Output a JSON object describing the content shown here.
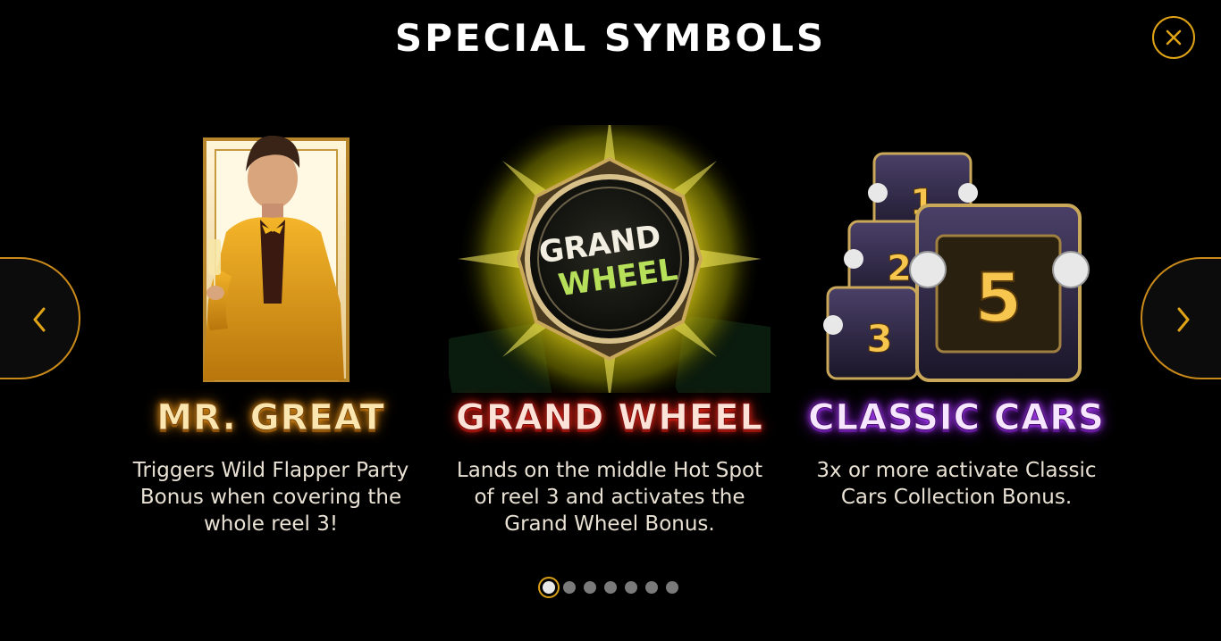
{
  "header": {
    "title": "SPECIAL SYMBOLS"
  },
  "icons": {
    "close": "close-icon",
    "prev": "chevron-left-icon",
    "next": "chevron-right-icon"
  },
  "colors": {
    "accent": "#e0a316",
    "background": "#000000"
  },
  "symbols": [
    {
      "name": "MR. GREAT",
      "description": "Triggers Wild Flapper Party Bonus when covering the whole reel 3!",
      "glow": "#d98a14"
    },
    {
      "name": "GRAND WHEEL",
      "description": "Lands on the middle Hot Spot of reel 3 and activates the Grand Wheel Bonus.",
      "badge_line1": "GRAND",
      "badge_line2": "WHEEL",
      "glow": "#e0261a"
    },
    {
      "name": "CLASSIC CARS",
      "description": "3x or more activate Classic Cars Collection Bonus.",
      "car_numbers": [
        "1",
        "2",
        "3",
        "5"
      ],
      "glow": "#b040ff"
    }
  ],
  "pagination": {
    "total": 7,
    "current": 1
  }
}
